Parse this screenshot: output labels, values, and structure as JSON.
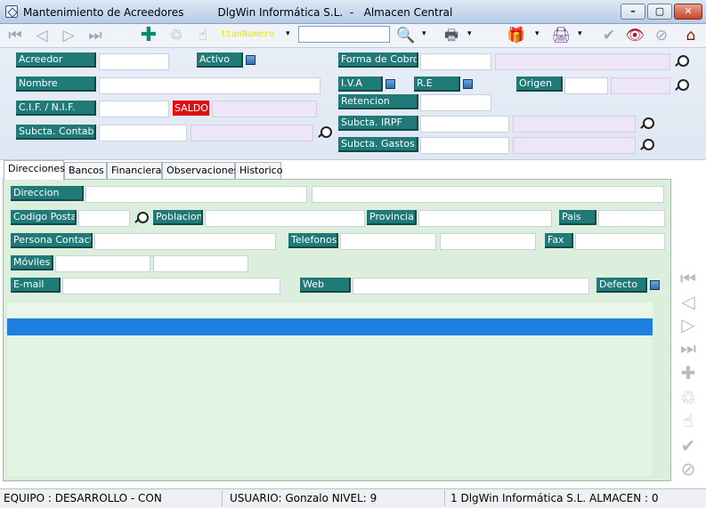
{
  "window": {
    "title": "Mantenimiento de Acreedores          DlgWin Informática S.L.  -   Almacen Central",
    "minimize": "–",
    "maximize": "▢",
    "close": "✕"
  },
  "toolbar": {
    "search_label": "ttanNumero",
    "search_value": "",
    "caret": "▾",
    "icons": [
      "first-icon",
      "prev-icon",
      "next-icon",
      "last-icon",
      "add-icon",
      "delete-icon",
      "edit-icon",
      "search-icon",
      "print-icon",
      "gift-icon",
      "printer2-icon",
      "check-icon",
      "eye-icon",
      "cancel-icon",
      "exit-icon"
    ]
  },
  "header": {
    "acreedor_label": "Acreedor",
    "acreedor_value": "",
    "activo_label": "Activo",
    "forma_cobro_label": "Forma de Cobro",
    "forma_cobro_code": "",
    "forma_cobro_desc": "",
    "nombre_label": "Nombre",
    "nombre_value": "",
    "iva_label": "I.V.A",
    "re_label": "R.E",
    "origen_label": "Origen",
    "origen_code": "",
    "origen_desc": "",
    "cif_label": "C.I.F. / N.I.F.",
    "cif_value": "",
    "saldo_label": "SALDO",
    "saldo_value": "",
    "retencion_label": "Retencion",
    "retencion_value": "",
    "subcta_contable_label": "Subcta. Contable",
    "subcta_contable_code": "",
    "subcta_contable_desc": "",
    "subcta_irpf_label": "Subcta. IRPF",
    "subcta_irpf_code": "",
    "subcta_irpf_desc": "",
    "subcta_gastos_label": "Subcta. Gastos",
    "subcta_gastos_code": "",
    "subcta_gastos_desc": ""
  },
  "tabs": [
    {
      "label": "Direcciones"
    },
    {
      "label": "Bancos"
    },
    {
      "label": "Financiera"
    },
    {
      "label": "Observaciones"
    },
    {
      "label": "Historico"
    }
  ],
  "direcciones": {
    "direccion_label": "Direccion",
    "codigo_postal_label": "Codigo Postal",
    "poblacion_label": "Poblacion",
    "provincia_label": "Provincia",
    "pais_label": "Pais",
    "persona_contacto_label": "Persona Contacto",
    "telefonos_label": "Telefonos",
    "fax_label": "Fax",
    "moviles_label": "Móviles",
    "email_label": "E-mail",
    "web_label": "Web",
    "defecto_label": "Defecto"
  },
  "status": {
    "equipo": "EQUIPO : DESARROLLO - CON",
    "usuario": "USUARIO: Gonzalo   NIVEL: 9",
    "empresa": "1 DlgWin Informática S.L.  ALMACEN : 0"
  }
}
